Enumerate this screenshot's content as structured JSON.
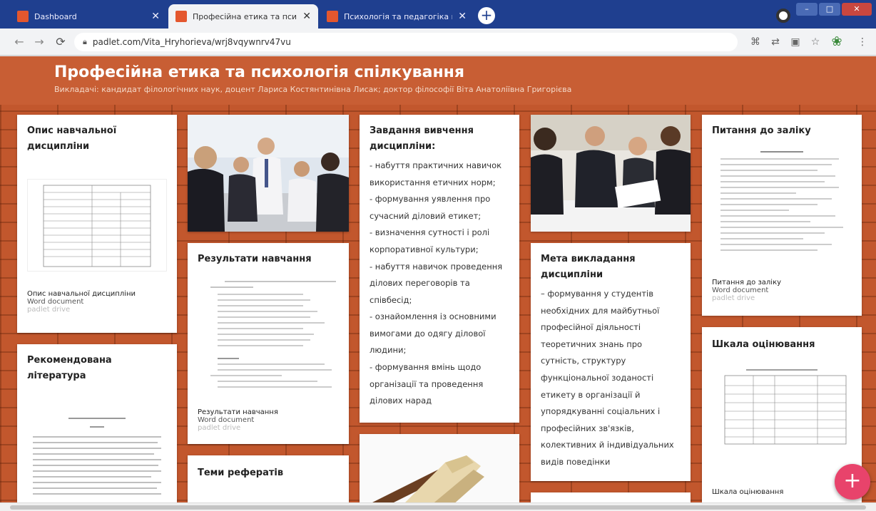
{
  "browser": {
    "tabs": [
      {
        "title": "Dashboard",
        "active": false
      },
      {
        "title": "Професійна етика та психологі",
        "active": true
      },
      {
        "title": "Психологія та педагогіка вищ",
        "active": false
      }
    ],
    "url": "padlet.com/Vita_Hryhorieva/wrj8vqywnrv47vu"
  },
  "padlet": {
    "title": "Професійна етика та психологія спілкування",
    "subtitle": "Викладачі: кандидат філологічних наук, доцент Лариса Костянтинівна Лисак; доктор філософії Віта Анатоліївна Григорієва"
  },
  "cards": {
    "opys": {
      "title": "Опис навчальної дисципліни",
      "att_title": "Опис навчальної дисципліни",
      "att_type": "Word document",
      "att_src": "padlet drive"
    },
    "literatura": {
      "title": "Рекомендована література"
    },
    "rezultaty": {
      "title": "Результати навчання",
      "att_title": "Результати навчання",
      "att_type": "Word document",
      "att_src": "padlet drive"
    },
    "temy": {
      "title": "Теми рефератів"
    },
    "zavdannia": {
      "title": "Завдання вивчення дисципліни:",
      "lines": [
        "- набуття практичних навичок",
        "використання етичних норм;",
        "- формування уявлення про",
        "сучасний діловий етикет;",
        " - визначення сутності і ролі",
        "корпоративної культури;",
        "- набуття навичок проведення",
        "ділових переговорів та",
        "співбесід;",
        "- ознайомлення із основними",
        "вимогами до одягу ділової",
        "людини;",
        "- формування вмінь щодо",
        "організації та проведення",
        "ділових нарад"
      ]
    },
    "meta": {
      "title": "Мета викладання дисципліни",
      "lines": [
        "– формування у студентів",
        "необхідних для майбутньої",
        "професійної діяльності",
        "теоретичних знань про",
        "сутність, структуру",
        "функціональної зоданості",
        "етикету в організації й",
        "упорядкуванні соціальних і",
        "професійних зв'язків,",
        "колективних й індивідуальних",
        "видів поведінки"
      ]
    },
    "pytannia": {
      "title": "Питання до заліку",
      "att_title": "Питання до заліку",
      "att_type": "Word document",
      "att_src": "padlet drive"
    },
    "shkala": {
      "title": "Шкала оцінювання",
      "att_title": "Шкала оцінювання"
    }
  },
  "fab_label": "+"
}
